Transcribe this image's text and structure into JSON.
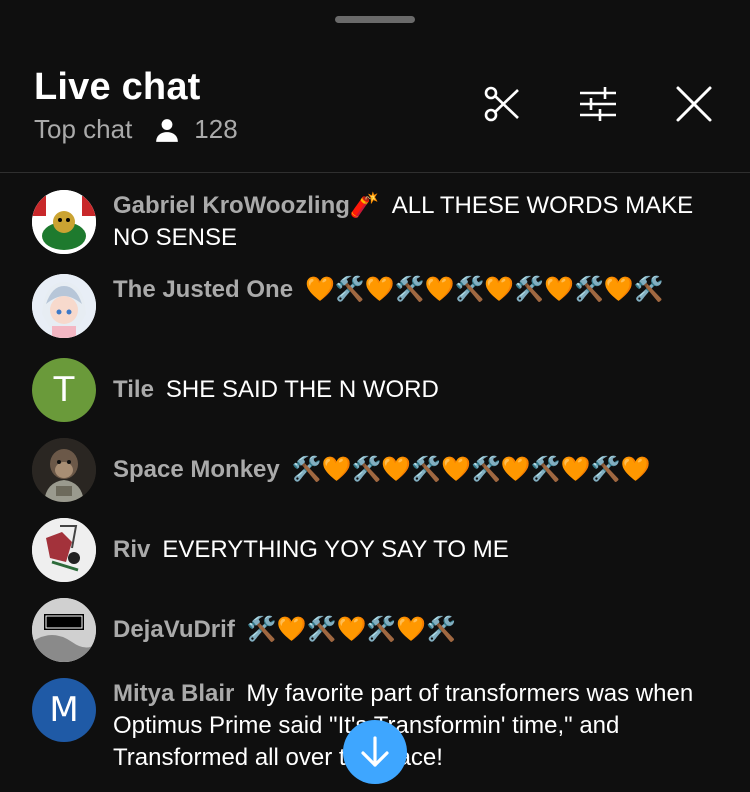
{
  "header": {
    "title": "Live chat",
    "mode": "Top chat",
    "viewer_count": "128"
  },
  "messages": [
    {
      "author": "Gabriel KroWoozling🧨",
      "text": "ALL THESE WORDS MAKE NO SENSE"
    },
    {
      "author": "The Justed One",
      "text": "🧡🛠️🧡🛠️🧡🛠️🧡🛠️🧡🛠️🧡🛠️"
    },
    {
      "author": "Tile",
      "text": "SHE SAID THE N WORD",
      "avatar_letter": "T",
      "avatar_color": "#6a9a3a"
    },
    {
      "author": "Space Monkey",
      "text": "🛠️🧡🛠️🧡🛠️🧡🛠️🧡🛠️🧡🛠️🧡"
    },
    {
      "author": "Riv",
      "text": "EVERYTHING YOY SAY TO ME"
    },
    {
      "author": "DejaVuDrif",
      "text": "🛠️🧡🛠️🧡🛠️🧡🛠️",
      "avatar_label": "PARENTAL ADVISORY EXPLICIT CONTENT"
    },
    {
      "author": "Mitya Blair",
      "text": "My favorite part of transformers was when Optimus Prime said \"It's Transformin' time,\" and Transformed all over the place!",
      "avatar_letter": "M",
      "avatar_color": "#1f5aa6"
    }
  ],
  "colors": {
    "background": "#0f0f0f",
    "author": "#aaaaaa",
    "accent": "#3ea6ff"
  },
  "icons": [
    "scissors-icon",
    "filter-sliders-icon",
    "close-icon",
    "person-icon",
    "arrow-down-icon"
  ]
}
